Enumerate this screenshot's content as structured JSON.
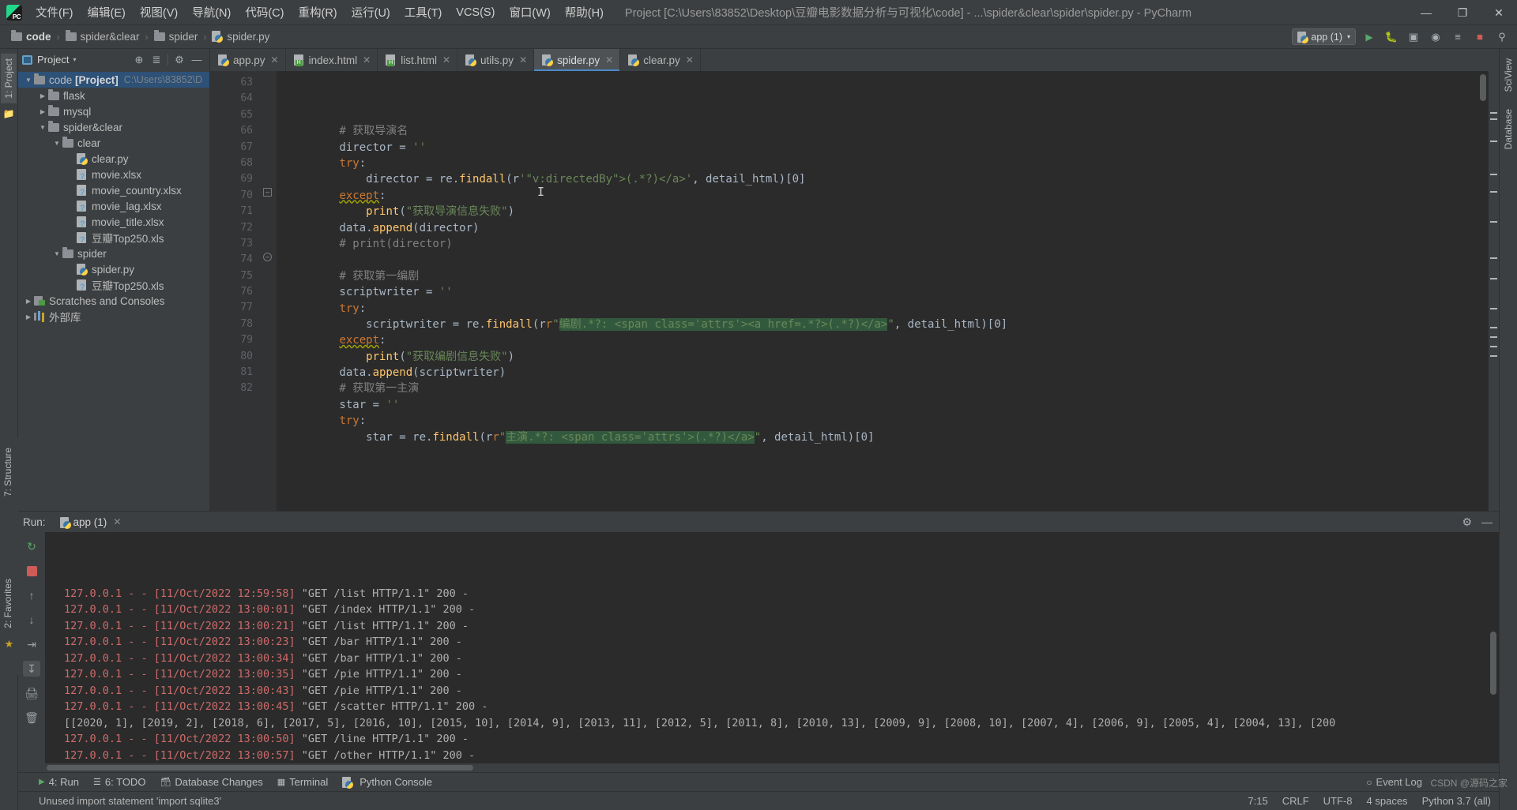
{
  "titlebar": {
    "logo_name": "pycharm-logo",
    "menus": [
      {
        "label": "文件(F)"
      },
      {
        "label": "编辑(E)"
      },
      {
        "label": "视图(V)"
      },
      {
        "label": "导航(N)"
      },
      {
        "label": "代码(C)"
      },
      {
        "label": "重构(R)"
      },
      {
        "label": "运行(U)"
      },
      {
        "label": "工具(T)"
      },
      {
        "label": "VCS(S)"
      },
      {
        "label": "窗口(W)"
      },
      {
        "label": "帮助(H)"
      }
    ],
    "window_title": "Project [C:\\Users\\83852\\Desktop\\豆瓣电影数据分析与可视化\\code] - ...\\spider&clear\\spider\\spider.py - PyCharm",
    "minimize": "—",
    "maximize": "❐",
    "close": "✕"
  },
  "breadcrumb": {
    "items": [
      {
        "label": "code",
        "icon": "folder-icon",
        "bold": true
      },
      {
        "label": "spider&clear",
        "icon": "folder-icon",
        "bold": false
      },
      {
        "label": "spider",
        "icon": "folder-icon",
        "bold": false
      },
      {
        "label": "spider.py",
        "icon": "python-file-icon",
        "bold": false
      }
    ],
    "separator": "›"
  },
  "navbar_right": {
    "run_config": "app (1)",
    "run_config_caret": "▾",
    "buttons": [
      {
        "name": "rerun-icon",
        "glyph": "↻"
      },
      {
        "name": "debug-icon",
        "glyph": "⚙"
      },
      {
        "name": "coverage-icon",
        "glyph": "▣"
      },
      {
        "name": "profile-icon",
        "glyph": "◔"
      },
      {
        "name": "run-with-tests-icon",
        "glyph": "≡"
      },
      {
        "name": "stop-icon",
        "glyph": "■"
      },
      {
        "name": "search-everywhere-icon",
        "glyph": "⚲"
      }
    ]
  },
  "left_strip": {
    "project_tab": "1: Project",
    "structure_tab": "7: Structure",
    "favorites_tab": "2: Favorites",
    "star_icon": "star-icon"
  },
  "right_strip": {
    "sciview_tab": "SciView",
    "database_tab": "Database"
  },
  "project_panel": {
    "title": "Project",
    "caret": "▾",
    "toolbar": [
      {
        "name": "locate-icon",
        "glyph": "⊕"
      },
      {
        "name": "collapse-all-icon",
        "glyph": "≡"
      },
      {
        "name": "settings-gear-icon",
        "glyph": "⚙"
      },
      {
        "name": "hide-panel-icon",
        "glyph": "—"
      }
    ],
    "tree": [
      {
        "indent": 0,
        "twisty": "down",
        "icon": "folder-icon",
        "label": "code",
        "bold_label": "[Project]",
        "path": "C:\\Users\\83852\\D",
        "selected": true
      },
      {
        "indent": 1,
        "twisty": "right",
        "icon": "folder-icon",
        "label": "flask",
        "selected": false
      },
      {
        "indent": 1,
        "twisty": "right",
        "icon": "folder-db-icon",
        "label": "mysql",
        "selected": false
      },
      {
        "indent": 1,
        "twisty": "down",
        "icon": "folder-icon",
        "label": "spider&clear",
        "selected": false
      },
      {
        "indent": 2,
        "twisty": "down",
        "icon": "folder-icon",
        "label": "clear",
        "selected": false
      },
      {
        "indent": 3,
        "twisty": "none",
        "icon": "python-file-icon",
        "label": "clear.py",
        "selected": false
      },
      {
        "indent": 3,
        "twisty": "none",
        "icon": "unknown-file-icon",
        "label": "movie.xlsx",
        "selected": false
      },
      {
        "indent": 3,
        "twisty": "none",
        "icon": "unknown-file-icon",
        "label": "movie_country.xlsx",
        "selected": false
      },
      {
        "indent": 3,
        "twisty": "none",
        "icon": "unknown-file-icon",
        "label": "movie_lag.xlsx",
        "selected": false
      },
      {
        "indent": 3,
        "twisty": "none",
        "icon": "unknown-file-icon",
        "label": "movie_title.xlsx",
        "selected": false
      },
      {
        "indent": 3,
        "twisty": "none",
        "icon": "unknown-file-icon",
        "label": "豆瓣Top250.xls",
        "selected": false
      },
      {
        "indent": 2,
        "twisty": "down",
        "icon": "folder-icon",
        "label": "spider",
        "selected": false
      },
      {
        "indent": 3,
        "twisty": "none",
        "icon": "python-file-icon",
        "label": "spider.py",
        "selected": false
      },
      {
        "indent": 3,
        "twisty": "none",
        "icon": "unknown-file-icon",
        "label": "豆瓣Top250.xls",
        "selected": false
      },
      {
        "indent": 0,
        "twisty": "right",
        "icon": "scratches-icon",
        "label": "Scratches and Consoles",
        "selected": false
      },
      {
        "indent": 0,
        "twisty": "right",
        "icon": "library-icon",
        "label": "外部库",
        "selected": false
      }
    ]
  },
  "editor": {
    "tabs": [
      {
        "label": "app.py",
        "icon": "python-file-icon",
        "active": false,
        "close": "✕"
      },
      {
        "label": "index.html",
        "icon": "html-file-icon",
        "active": false,
        "close": "✕"
      },
      {
        "label": "list.html",
        "icon": "html-file-icon",
        "active": false,
        "close": "✕"
      },
      {
        "label": "utils.py",
        "icon": "python-file-icon",
        "active": false,
        "close": "✕"
      },
      {
        "label": "spider.py",
        "icon": "python-file-icon",
        "active": true,
        "close": "✕"
      },
      {
        "label": "clear.py",
        "icon": "python-file-icon",
        "active": false,
        "close": "✕"
      }
    ],
    "first_line_number": 63,
    "lines": [
      {
        "n": 63,
        "text": "        # 获取导演名"
      },
      {
        "n": 64,
        "text": "        director = ''"
      },
      {
        "n": 65,
        "text": "        try:"
      },
      {
        "n": 66,
        "text": "            director = re.findall(r'\"v:directedBy\">(.*?)</a>', detail_html)[0]"
      },
      {
        "n": 67,
        "text": "        except:"
      },
      {
        "n": 68,
        "text": "            print(\"获取导演信息失败\")"
      },
      {
        "n": 69,
        "text": "        data.append(director)"
      },
      {
        "n": 70,
        "text": "        # print(director)"
      },
      {
        "n": 71,
        "text": ""
      },
      {
        "n": 72,
        "text": "        # 获取第一编剧"
      },
      {
        "n": 73,
        "text": "        scriptwriter = ''"
      },
      {
        "n": 74,
        "text": "        try:"
      },
      {
        "n": 75,
        "text": "            scriptwriter = re.findall(r\"编剧.*?: <span class='attrs'><a href=.*?>(.*?)</a>\", detail_html)[0]"
      },
      {
        "n": 76,
        "text": "        except:"
      },
      {
        "n": 77,
        "text": "            print(\"获取编剧信息失败\")"
      },
      {
        "n": 78,
        "text": "        data.append(scriptwriter)"
      },
      {
        "n": 79,
        "text": "        # 获取第一主演"
      },
      {
        "n": 80,
        "text": "        star = ''"
      },
      {
        "n": 81,
        "text": "        try:"
      },
      {
        "n": 82,
        "text": "            star = re.findall(r\"主演.*?: <span class='attrs'>(.*?)</a>\", detail_html)[0]"
      }
    ]
  },
  "run_panel": {
    "label": "Run:",
    "tab_label": "app (1)",
    "tab_icon": "python-file-icon",
    "tab_close": "✕",
    "settings_icon": "gear-icon",
    "hide_icon": "—",
    "toolbar": [
      {
        "name": "rerun-icon",
        "glyph": "↻"
      },
      {
        "name": "stop-icon",
        "glyph": "■"
      },
      {
        "name": "scroll-up-icon",
        "glyph": "↑"
      },
      {
        "name": "scroll-down-icon",
        "glyph": "↓"
      },
      {
        "name": "print-icon",
        "glyph": "⎙"
      },
      {
        "name": "soft-wrap-icon",
        "glyph": "↵"
      },
      {
        "name": "scroll-to-end-icon",
        "glyph": "↧"
      },
      {
        "name": "print-output-icon",
        "glyph": "⎙"
      },
      {
        "name": "clear-all-icon",
        "glyph": "Ὕ1"
      }
    ],
    "output": [
      {
        "addr": "127.0.0.1 - - [11/Oct/2022 12:59:58] ",
        "rest": "\"GET /list HTTP/1.1\" 200 -"
      },
      {
        "addr": "127.0.0.1 - - [11/Oct/2022 13:00:01] ",
        "rest": "\"GET /index HTTP/1.1\" 200 -"
      },
      {
        "addr": "127.0.0.1 - - [11/Oct/2022 13:00:21] ",
        "rest": "\"GET /list HTTP/1.1\" 200 -"
      },
      {
        "addr": "127.0.0.1 - - [11/Oct/2022 13:00:23] ",
        "rest": "\"GET /bar HTTP/1.1\" 200 -"
      },
      {
        "addr": "127.0.0.1 - - [11/Oct/2022 13:00:34] ",
        "rest": "\"GET /bar HTTP/1.1\" 200 -"
      },
      {
        "addr": "127.0.0.1 - - [11/Oct/2022 13:00:35] ",
        "rest": "\"GET /pie HTTP/1.1\" 200 -"
      },
      {
        "addr": "127.0.0.1 - - [11/Oct/2022 13:00:43] ",
        "rest": "\"GET /pie HTTP/1.1\" 200 -"
      },
      {
        "addr": "127.0.0.1 - - [11/Oct/2022 13:00:45] ",
        "rest": "\"GET /scatter HTTP/1.1\" 200 -"
      },
      {
        "addr": "",
        "rest": "[[2020, 1], [2019, 2], [2018, 6], [2017, 5], [2016, 10], [2015, 10], [2014, 9], [2013, 11], [2012, 5], [2011, 8], [2010, 13], [2009, 9], [2008, 10], [2007, 4], [2006, 9], [2005, 4], [2004, 13], [200"
      },
      {
        "addr": "127.0.0.1 - - [11/Oct/2022 13:00:50] ",
        "rest": "\"GET /line HTTP/1.1\" 200 -"
      },
      {
        "addr": "127.0.0.1 - - [11/Oct/2022 13:00:57] ",
        "rest": "\"GET /other HTTP/1.1\" 200 -"
      }
    ]
  },
  "toolwindow_bar": {
    "items": [
      {
        "label": "4: Run",
        "icon": "play-icon",
        "underline": "4"
      },
      {
        "label": "6: TODO",
        "icon": "todo-icon",
        "underline": "6"
      },
      {
        "label": "Database Changes",
        "icon": "database-icon"
      },
      {
        "label": "Terminal",
        "icon": "terminal-icon"
      },
      {
        "label": "Python Console",
        "icon": "python-console-icon"
      }
    ]
  },
  "statusbar": {
    "message": "Unused import statement 'import sqlite3'",
    "caret_position": "7:15",
    "line_separator": "CRLF",
    "encoding": "UTF-8",
    "indent": "4 spaces",
    "interpreter": "Python 3.7 (all)",
    "event_log": "Event Log",
    "event_log_icon": "bell-icon",
    "watermark": "CSDN @源码之家"
  },
  "colors": {
    "bg_chrome": "#3c3f41",
    "bg_editor": "#2b2b2b",
    "gutter": "#313335",
    "accent_blue": "#4a88c7",
    "selection_blue": "#2d5177",
    "console_red": "#cf6a6a",
    "string_green": "#6a8759",
    "keyword_orange": "#cc7832",
    "comment_grey": "#808080"
  }
}
